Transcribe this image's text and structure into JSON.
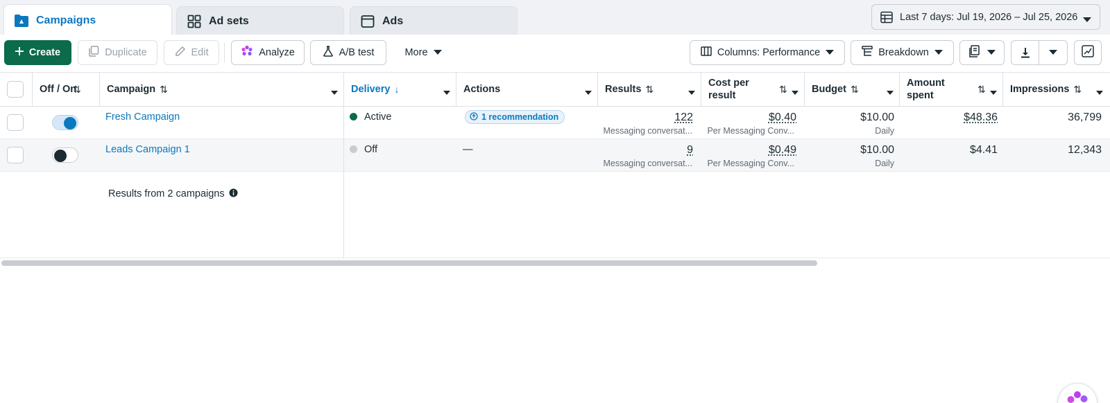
{
  "tabs": [
    {
      "label": "Campaigns",
      "icon": "folder-icon",
      "active": true
    },
    {
      "label": "Ad sets",
      "icon": "grid-icon",
      "active": false
    },
    {
      "label": "Ads",
      "icon": "ad-window-icon",
      "active": false
    }
  ],
  "date_range": {
    "label": "Last 7 days: Jul 19, 2026 – Jul 25, 2026"
  },
  "toolbar": {
    "create": "Create",
    "duplicate": "Duplicate",
    "edit": "Edit",
    "analyze": "Analyze",
    "ab_test": "A/B test",
    "more": "More",
    "columns": "Columns: Performance",
    "breakdown": "Breakdown"
  },
  "headers": {
    "off_on": "Off / On",
    "campaign": "Campaign",
    "delivery": "Delivery",
    "actions": "Actions",
    "results": "Results",
    "cost_per_result_1": "Cost per",
    "cost_per_result_2": "result",
    "budget": "Budget",
    "amount_spent_1": "Amount",
    "amount_spent_2": "spent",
    "impressions": "Impressions"
  },
  "rows": [
    {
      "on": true,
      "campaign": "Fresh Campaign",
      "delivery": "Active",
      "delivery_color": "#0b6b4a",
      "actions": "1 recommendation",
      "results": "122",
      "results_sub": "Messaging conversat...",
      "cost": "$0.40",
      "cost_sub": "Per Messaging Conv...",
      "budget": "$10.00",
      "budget_sub": "Daily",
      "spent": "$48.36",
      "impressions": "36,799"
    },
    {
      "on": false,
      "campaign": "Leads Campaign 1",
      "delivery": "Off",
      "delivery_color": "#c8ccd1",
      "actions": "—",
      "results": "9",
      "results_sub": "Messaging conversat...",
      "cost": "$0.49",
      "cost_sub": "Per Messaging Conv...",
      "budget": "$10.00",
      "budget_sub": "Daily",
      "spent": "$4.41",
      "impressions": "12,343"
    }
  ],
  "footer": {
    "summary": "Results from 2 campaigns"
  },
  "colors": {
    "accent": "#0a78be",
    "primary": "#0b6b4a"
  }
}
